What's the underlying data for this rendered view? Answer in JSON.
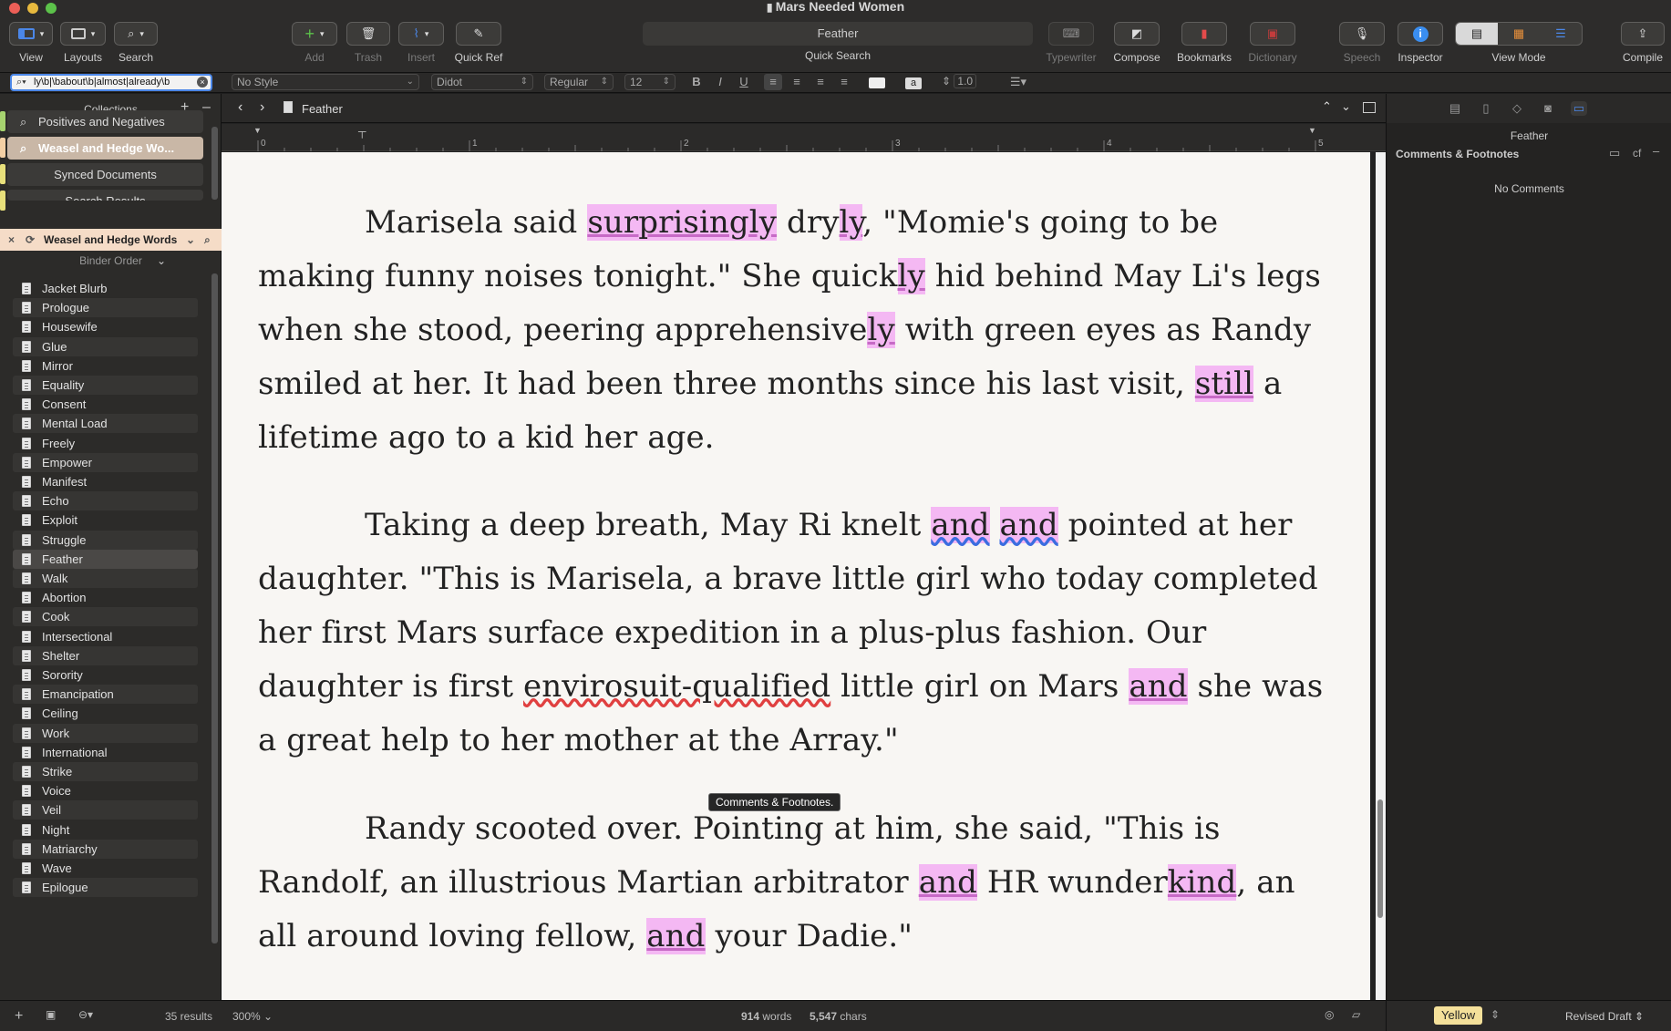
{
  "window": {
    "title": "Mars Needed Women"
  },
  "toolbar": {
    "view": "View",
    "layouts": "Layouts",
    "search": "Search",
    "add": "Add",
    "trash": "Trash",
    "insert": "Insert",
    "quickref": "Quick Ref",
    "quicksearch_value": "Feather",
    "quicksearch_label": "Quick Search",
    "typewriter": "Typewriter",
    "compose": "Compose",
    "bookmarks": "Bookmarks",
    "dictionary": "Dictionary",
    "speech": "Speech",
    "inspector": "Inspector",
    "viewmode": "View Mode",
    "compile": "Compile"
  },
  "formatbar": {
    "search_value": "ly\\b|\\babout\\b|almost|already\\b",
    "style": "No Style",
    "font": "Didot",
    "weight": "Regular",
    "size": "12",
    "bold": "B",
    "italic": "I",
    "underline": "U",
    "highlight_char": "a",
    "line_spacing": "1.0"
  },
  "sidebar": {
    "collections_title": "Collections",
    "collections": [
      {
        "label": "Positives and Negatives",
        "color": "#a6d36f"
      },
      {
        "label": "Weasel and Hedge Wo...",
        "color": "#f3d0a5"
      },
      {
        "label": "Synced Documents",
        "color": "#e8e07b"
      },
      {
        "label": "Search Results",
        "color": "#e8e07b"
      }
    ],
    "search_collection": "Weasel and Hedge Words",
    "binder_order": "Binder Order",
    "items": [
      "Jacket Blurb",
      "Prologue",
      "Housewife",
      "Glue",
      "Mirror",
      "Equality",
      "Consent",
      "Mental Load",
      "Freely",
      "Empower",
      "Manifest",
      "Echo",
      "Exploit",
      "Struggle",
      "Feather",
      "Walk",
      "Abortion",
      "Cook",
      "Intersectional",
      "Shelter",
      "Sorority",
      "Emancipation",
      "Ceiling",
      "Work",
      "International",
      "Strike",
      "Voice",
      "Veil",
      "Night",
      "Matriarchy",
      "Wave",
      "Epilogue"
    ],
    "selected": "Feather",
    "results": "35 results"
  },
  "editor": {
    "doc_title": "Feather",
    "ruler": [
      "0",
      "1",
      "2",
      "3",
      "4",
      "5"
    ],
    "p1": {
      "a": "Marisela said ",
      "b": "surprisingly",
      "c": " dry",
      "d": "ly",
      "e": ", \"Momie's going to be making funny noises tonight.\" She quick",
      "f": "ly",
      "g": " hid behind May Li's legs when she stood, peering apprehensive",
      "h": "ly",
      "i": " with green eyes as Randy smiled at her. It had been three months since his last visit, ",
      "j": "still",
      "k": " a lifetime ago to a kid her age."
    },
    "p2": {
      "a": "Taking a deep breath, May Ri knelt ",
      "b": "and",
      "c": " ",
      "d": "and",
      "e": " pointed at her daughter. \"This is Marisela, a brave little girl who today completed her first Mars surface expedition in a plus-plus fashion. Our daughter is first ",
      "f": "envirosuit-qualified",
      "g": " little girl on Mars ",
      "h": "and",
      "i": " she was a great help to her mother at the Array.\""
    },
    "p3": {
      "a": "Randy scooted over. Pointing at him, she said, \"This is Randolf, an illustrious Martian arbitrator ",
      "b": "and",
      "c": " HR wunder",
      "d": "kind",
      "e": ", an all around loving fellow, ",
      "f": "and",
      "g": " your Dadie.\""
    },
    "tooltip": "Comments & Footnotes.",
    "zoom": "300%",
    "words_count": "914",
    "words_label": "words",
    "chars_count": "5,547",
    "chars_label": "chars"
  },
  "inspector": {
    "doc_title": "Feather",
    "section": "Comments & Footnotes",
    "cf": "cf",
    "empty": "No Comments",
    "label_value": "Yellow",
    "status_value": "Revised Draft"
  },
  "colors": {
    "highlight": "#f4b8f3",
    "accent": "#4b87e8",
    "page": "#f8f6f3"
  }
}
